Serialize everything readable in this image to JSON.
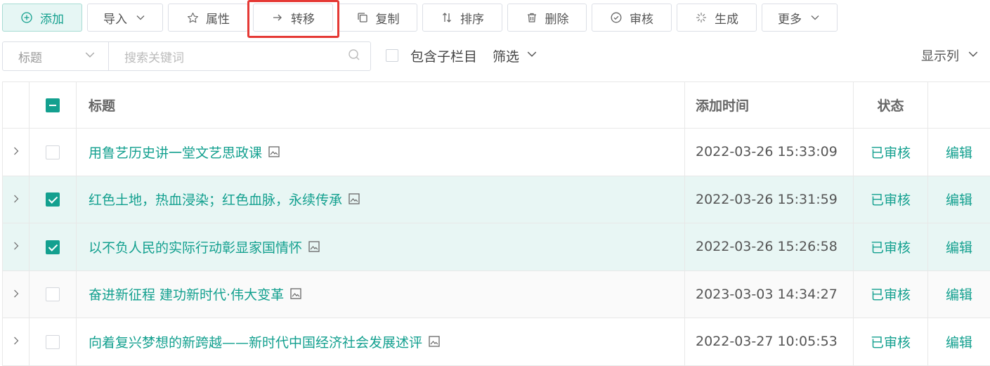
{
  "toolbar": {
    "add": "添加",
    "import": "导入",
    "attributes": "属性",
    "transfer": "转移",
    "copy": "复制",
    "sort": "排序",
    "delete": "删除",
    "review": "审核",
    "generate": "生成",
    "more": "更多"
  },
  "search": {
    "field_selected": "标题",
    "placeholder": "搜索关键词",
    "include_sub": "包含子栏目",
    "filter": "筛选",
    "show_columns": "显示列"
  },
  "table": {
    "headers": {
      "title": "标题",
      "added_time": "添加时间",
      "status": "状态"
    },
    "rows": [
      {
        "title": "用鲁艺历史讲一堂文艺思政课",
        "time": "2022-03-26 15:33:09",
        "status": "已审核",
        "action": "编辑",
        "checked": false
      },
      {
        "title": "红色土地，热血浸染；红色血脉，永续传承",
        "time": "2022-03-26 15:31:59",
        "status": "已审核",
        "action": "编辑",
        "checked": true
      },
      {
        "title": "以不负人民的实际行动彰显家国情怀",
        "time": "2022-03-26 15:26:58",
        "status": "已审核",
        "action": "编辑",
        "checked": true
      },
      {
        "title": "奋进新征程 建功新时代·伟大变革",
        "time": "2023-03-03 14:34:27",
        "status": "已审核",
        "action": "编辑",
        "checked": false
      },
      {
        "title": "向着复兴梦想的新跨越——新时代中国经济社会发展述评",
        "time": "2022-03-27 10:05:53",
        "status": "已审核",
        "action": "编辑",
        "checked": false
      }
    ]
  },
  "colors": {
    "accent": "#13a08f",
    "highlight": "#e53935",
    "selected_row": "#e8f6f4"
  }
}
